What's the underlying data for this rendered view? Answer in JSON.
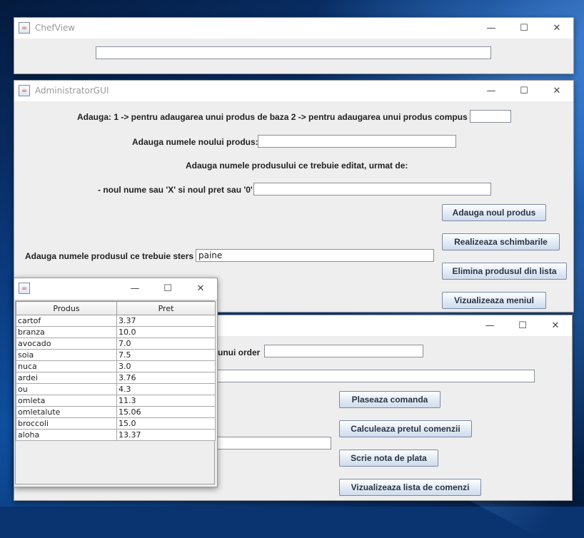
{
  "chef": {
    "title": "ChefView",
    "field_value": ""
  },
  "admin": {
    "title": "AdministratorGUI",
    "instruction": "Adauga: 1 -> pentru adaugarea unui produs de baza  2 ->  pentru adaugarea unui produs compus",
    "type_value": "",
    "name_label": "Adauga numele noului produs:",
    "name_value": "",
    "edit_label": "Adauga numele produsului ce trebuie editat, urmat de:",
    "edit_sub_label": "- noul nume sau 'X' si noul pret sau '0'",
    "edit_value": "",
    "delete_label": "Adauga numele produsul ce trebuie sters",
    "delete_value": "paine",
    "buttons": {
      "add": "Adauga noul produs",
      "change": "Realizeaza schimbarile",
      "remove": "Elimina produsul din lista",
      "menu": "Vizualizeaza meniul"
    }
  },
  "waiter": {
    "order_label": "unui order",
    "order_value": "",
    "products_value": "",
    "bill_value": "",
    "buttons": {
      "place": "Plaseaza comanda",
      "compute": "Calculeaza pretul comenzii",
      "bill": "Scrie nota de plata",
      "orders": "Vizualizeaza lista de comenzi"
    }
  },
  "menu_table": {
    "columns": [
      "Produs",
      "Pret"
    ],
    "rows": [
      [
        "cartof",
        "3.37"
      ],
      [
        "branza",
        "10.0"
      ],
      [
        "avocado",
        "7.0"
      ],
      [
        "soia",
        "7.5"
      ],
      [
        "nuca",
        "3.0"
      ],
      [
        "ardei",
        "3.76"
      ],
      [
        "ou",
        "4.3"
      ],
      [
        "omleta",
        "11.3"
      ],
      [
        "omletalute",
        "15.06"
      ],
      [
        "broccoli",
        "15.0"
      ],
      [
        "aloha",
        "13.37"
      ]
    ]
  },
  "window_controls": {
    "minimize": "—",
    "maximize": "☐",
    "close": "✕"
  },
  "colors": {
    "window_bg": "#eeeeee",
    "button_border": "#7a8aa6",
    "desktop": "#0b3a7d"
  }
}
